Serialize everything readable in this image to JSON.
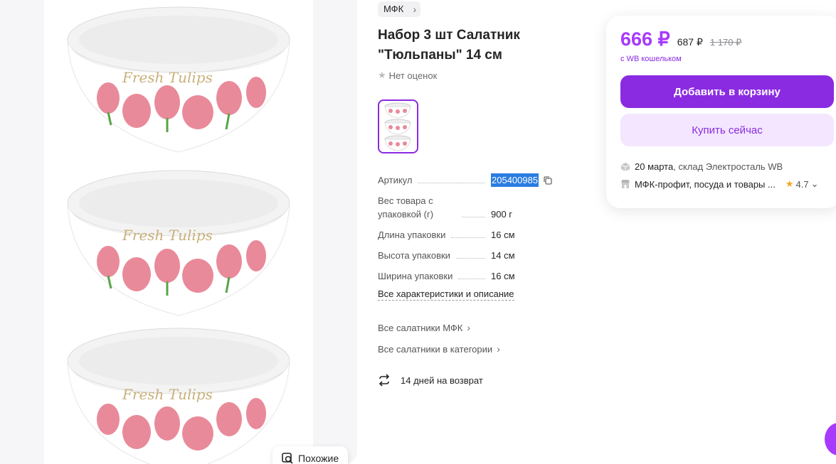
{
  "gallery": {
    "bowl_text": "Fresh Tulips",
    "similar_label": "Похожие"
  },
  "product": {
    "brand": "МФК",
    "title": "Набор 3 шт Салатник \"Тюльпаны\" 14 см",
    "rating_text": "Нет оценок"
  },
  "specs": [
    {
      "label": "Артикул",
      "value": "205400985"
    },
    {
      "label": "Вес товара с упаковкой (г)",
      "value": "900 г"
    },
    {
      "label": "Длина упаковки",
      "value": "16 см"
    },
    {
      "label": "Высота упаковки",
      "value": "14 см"
    },
    {
      "label": "Ширина упаковки",
      "value": "16 см"
    }
  ],
  "links": {
    "all_specs": "Все характеристики и описание",
    "all_brand_bowls": "Все салатники МФК",
    "all_category_bowls": "Все салатники в категории",
    "return_policy": "14 дней на возврат"
  },
  "price_card": {
    "price": "666 ₽",
    "old_price": "687 ₽",
    "crossed_price": "1 170 ₽",
    "wallet_note": "с WB кошельком",
    "add_to_cart": "Добавить в корзину",
    "buy_now": "Купить сейчас",
    "delivery_date": "20 марта",
    "delivery_warehouse": ", склад Электросталь WB",
    "seller_name": "МФК-профит, посуда и товары ...",
    "seller_rating": "4.7"
  },
  "colors": {
    "accent": "#8a2be2",
    "price": "#a73afd",
    "sku_highlight": "#2a7de1"
  }
}
